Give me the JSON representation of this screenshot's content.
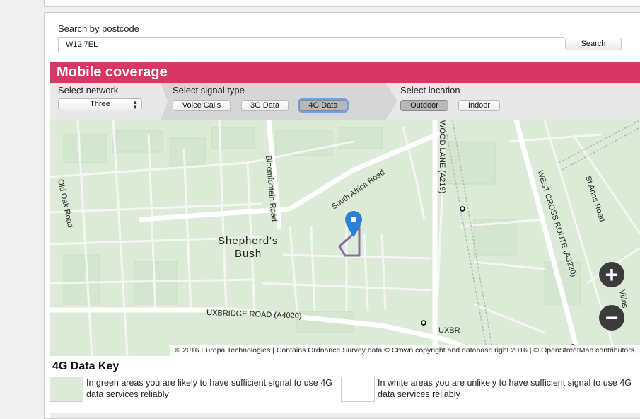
{
  "search": {
    "label": "Search by postcode",
    "value": "W12 7EL",
    "button_label": "Search"
  },
  "banner": {
    "title": "Mobile coverage"
  },
  "network": {
    "label": "Select network",
    "selected": "Three",
    "arrows": "▲\n▼"
  },
  "signal": {
    "label": "Select signal type",
    "options": [
      "Voice Calls",
      "3G Data",
      "4G Data"
    ],
    "selected": "4G Data"
  },
  "location": {
    "label": "Select location",
    "options": [
      "Outdoor",
      "Indoor"
    ],
    "selected": "Outdoor"
  },
  "map": {
    "labels": {
      "old_oak": "Old Oak Road",
      "bloemfontein": "Bloemfontein Road",
      "south_africa": "South Africa Road",
      "wood_lane": "WOOD LANE (A219)",
      "west_cross": "WEST CROSS ROUTE (A3220)",
      "st_anns": "St Anns Road",
      "shepherds": "Shepherd's",
      "bush": "Bush",
      "uxbridge": "UXBRIDGE ROAD (A4020)",
      "uxbr_cut": "UXBR",
      "villas": "Villas"
    },
    "attribution": "© 2016 Europa Technologies | Contains Ordnance Survey data © Crown copyright and database right 2016 | © OpenStreetMap contributors",
    "zoom_in": "+",
    "zoom_out": "−",
    "coverage_color": "#dcebd8",
    "marker_color": "#2b7fd4",
    "boundary_color": "#8a6aa3"
  },
  "key": {
    "title": "4G Data Key",
    "green_text": "In green areas you are likely to have sufficient signal to use 4G data services reliably",
    "white_text": "In white areas you are unlikely to have sufficient signal to use 4G data services reliably",
    "green_color": "#dcebd8",
    "white_color": "#ffffff"
  },
  "colors": {
    "accent": "#d93565"
  }
}
